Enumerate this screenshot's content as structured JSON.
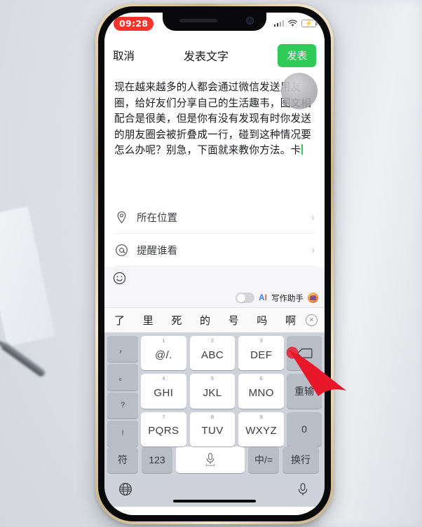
{
  "status_bar": {
    "time": "09:28",
    "time_badge_color": "#f5342c",
    "icons": [
      "cellular-signal-icon",
      "wifi-icon",
      "battery-charging-icon"
    ]
  },
  "nav_bar": {
    "cancel_label": "取消",
    "title": "发表文字",
    "post_label": "发表",
    "post_color": "#2ecc57"
  },
  "compose": {
    "text": "现在越来越多的人都会通过微信发送用友圈，给好友们分享自己的生活趣韦，图文相配合是很美，但是你有没有发现有时你发送的朋友圈会被折叠成一行，碰到这种情况要怎么办呢？别急，下面就来教你方法。卡",
    "caret_color": "#2ecc57",
    "assistive_touch": "assistive-touch-ball"
  },
  "options": [
    {
      "icon": "location-pin-icon",
      "label": "所在位置",
      "chevron": "›"
    },
    {
      "icon": "at-mention-icon",
      "label": "提醒谁看",
      "chevron": "›"
    }
  ],
  "toolbar": {
    "emoji_icon": "smiley-face-icon",
    "ai_toggle_state": "off",
    "ai_word": "AI",
    "ai_label": "写作助手",
    "ai_badge": "ai-assistant-badge-icon"
  },
  "candidate_bar": {
    "candidates": [
      "了",
      "里",
      "死",
      "的",
      "号",
      "吗",
      "啊"
    ],
    "close_label": "×"
  },
  "keyboard": {
    "punctuation_column": [
      "，",
      "。",
      "?",
      "!"
    ],
    "rows": [
      [
        {
          "num": "1",
          "letters": "@/."
        },
        {
          "num": "2",
          "letters": "ABC"
        },
        {
          "num": "3",
          "letters": "DEF"
        }
      ],
      [
        {
          "num": "4",
          "letters": "GHI"
        },
        {
          "num": "5",
          "letters": "JKL"
        },
        {
          "num": "6",
          "letters": "MNO"
        }
      ],
      [
        {
          "num": "7",
          "letters": "PQRS"
        },
        {
          "num": "8",
          "letters": "TUV"
        },
        {
          "num": "9",
          "letters": "WXYZ"
        }
      ]
    ],
    "right_column": [
      {
        "name": "delete-key",
        "label": ""
      },
      {
        "name": "redo-key",
        "label": "重输"
      },
      {
        "name": "zero-key",
        "label": "0"
      }
    ],
    "bottom_row": [
      {
        "name": "symbol-key",
        "label": "符"
      },
      {
        "name": "numeric-key",
        "label": "123"
      },
      {
        "name": "space-mic-key",
        "label": ""
      },
      {
        "name": "language-key",
        "label": "中/="
      },
      {
        "name": "newline-key",
        "label": "换行"
      }
    ]
  },
  "home_bar": {
    "globe_icon": "globe-icon",
    "mic_icon": "microphone-icon",
    "home_indicator": "home-indicator"
  },
  "overlay": {
    "cursor": "red-arrow-pointer",
    "cursor_color": "#e8182a"
  }
}
